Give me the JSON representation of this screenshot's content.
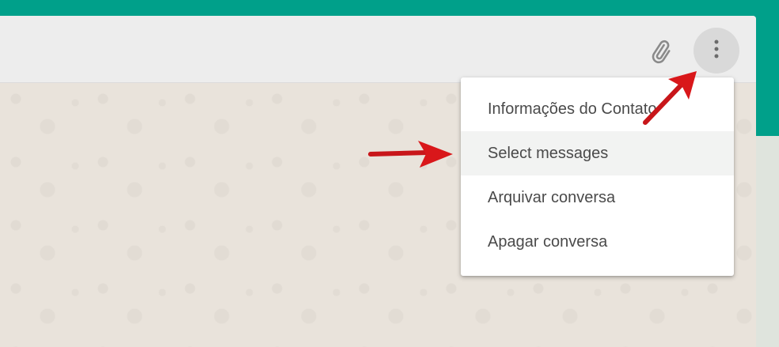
{
  "header": {
    "attach_icon": "paperclip-icon",
    "menu_icon": "three-dots-vertical-icon"
  },
  "menu": {
    "items": [
      {
        "label": "Informações do Contato"
      },
      {
        "label": "Select messages"
      },
      {
        "label": "Arquivar conversa"
      },
      {
        "label": "Apagar conversa"
      }
    ]
  },
  "colors": {
    "top_band": "#00a08a",
    "header_bg": "#ededed",
    "chat_wallpaper": "#e9e3db",
    "menu_bg": "#ffffff",
    "menu_hover": "#f2f3f2",
    "annotation_arrow": "#d9171a"
  }
}
